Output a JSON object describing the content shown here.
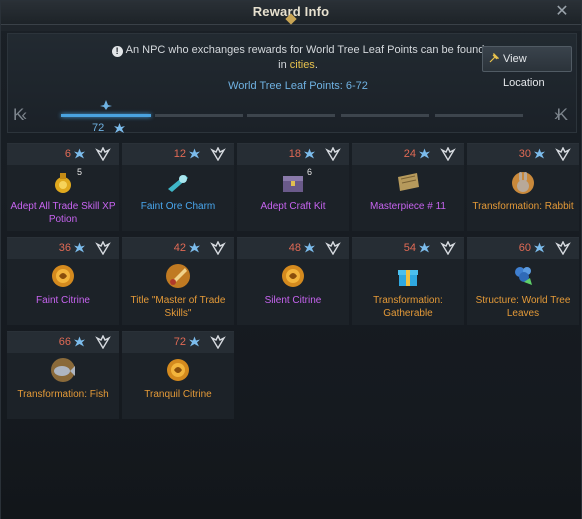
{
  "window": {
    "title": "Reward Info",
    "close": "✕"
  },
  "notice": {
    "text_before": "An NPC who exchanges rewards for World Tree Leaf Points can be found in",
    "highlight": "cities",
    "text_after": ".",
    "info_icon": "!"
  },
  "view_location": {
    "label": "View Location",
    "icon": "pin-icon"
  },
  "points": {
    "label": "World Tree Leaf Points: 6-72"
  },
  "progress": {
    "current_label": "72",
    "nav_left": "K‹",
    "nav_right": "›K",
    "active_segments": 1,
    "total_segments": 5
  },
  "colors": {
    "points_red": "#e06a55",
    "leaf_blue": "#6fb2e2",
    "epic_purple": "#c764f0",
    "rare_blue": "#49a7ee",
    "legendary_orange": "#e49a38",
    "accent_gold": "#e8c24d"
  },
  "rewards": [
    {
      "points": "6",
      "name": "Adept All Trade Skill XP Potion",
      "rarity": "purple",
      "icon": "potion-icon",
      "stack": "5"
    },
    {
      "points": "12",
      "name": "Faint Ore Charm",
      "rarity": "blue",
      "icon": "charm-icon",
      "stack": ""
    },
    {
      "points": "18",
      "name": "Adept Craft Kit",
      "rarity": "purple",
      "icon": "chest-icon",
      "stack": "6"
    },
    {
      "points": "24",
      "name": "Masterpiece # 11",
      "rarity": "purple",
      "icon": "scroll-icon",
      "stack": ""
    },
    {
      "points": "30",
      "name": "Transformation: Rabbit",
      "rarity": "orange",
      "icon": "rabbit-icon",
      "stack": ""
    },
    {
      "points": "36",
      "name": "Faint Citrine",
      "rarity": "purple",
      "icon": "citrine-icon",
      "stack": ""
    },
    {
      "points": "42",
      "name": "Title \"Master of Trade Skills\"",
      "rarity": "orange",
      "icon": "title-scroll-icon",
      "stack": ""
    },
    {
      "points": "48",
      "name": "Silent Citrine",
      "rarity": "purple",
      "icon": "citrine-icon",
      "stack": ""
    },
    {
      "points": "54",
      "name": "Transformation: Gatherable",
      "rarity": "orange",
      "icon": "gift-icon",
      "stack": ""
    },
    {
      "points": "60",
      "name": "Structure: World Tree Leaves",
      "rarity": "orange",
      "icon": "tree-icon",
      "stack": ""
    },
    {
      "points": "66",
      "name": "Transformation: Fish",
      "rarity": "orange",
      "icon": "fish-icon",
      "stack": ""
    },
    {
      "points": "72",
      "name": "Tranquil Citrine",
      "rarity": "orange",
      "icon": "citrine-icon",
      "stack": ""
    }
  ]
}
